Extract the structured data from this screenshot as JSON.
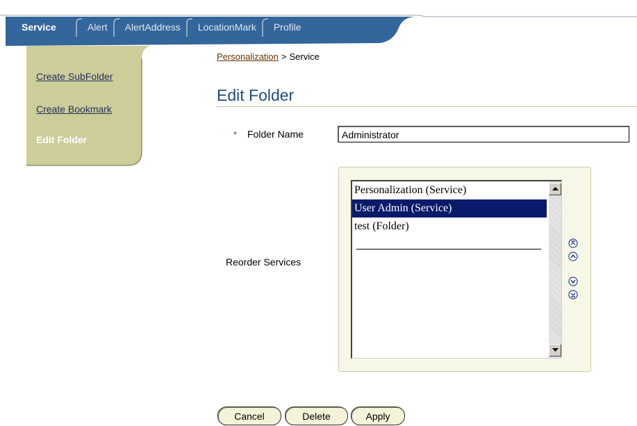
{
  "tabs": [
    {
      "label": "Service",
      "active": true
    },
    {
      "label": "Alert",
      "active": false
    },
    {
      "label": "AlertAddress",
      "active": false
    },
    {
      "label": "LocationMark",
      "active": false
    },
    {
      "label": "Profile",
      "active": false
    }
  ],
  "sidenav": {
    "items": [
      {
        "label": "Create SubFolder",
        "active": false
      },
      {
        "label": "Create Bookmark",
        "active": false
      },
      {
        "label": "Edit Folder",
        "active": true
      }
    ]
  },
  "breadcrumb": {
    "link": "Personalization",
    "separator": ">",
    "current": "Service"
  },
  "page": {
    "title": "Edit Folder"
  },
  "form": {
    "required_marker": "*",
    "folder_name_label": "Folder Name",
    "folder_name_value": "Administrator",
    "reorder_label": "Reorder Services",
    "services": [
      {
        "label": "Personalization (Service)",
        "selected": false
      },
      {
        "label": "User Admin (Service)",
        "selected": true
      },
      {
        "label": "test (Folder)",
        "selected": false
      }
    ],
    "move_icons": [
      "move-to-top-icon",
      "move-up-icon",
      "move-down-icon",
      "move-to-bottom-icon"
    ]
  },
  "buttons": {
    "cancel": "Cancel",
    "delete": "Delete",
    "apply": "Apply"
  },
  "colors": {
    "tabbar_bg": "#33669a",
    "sidenav_bg": "#cdcd99",
    "selection": "#0a1a6a",
    "title": "#1f4b80"
  }
}
